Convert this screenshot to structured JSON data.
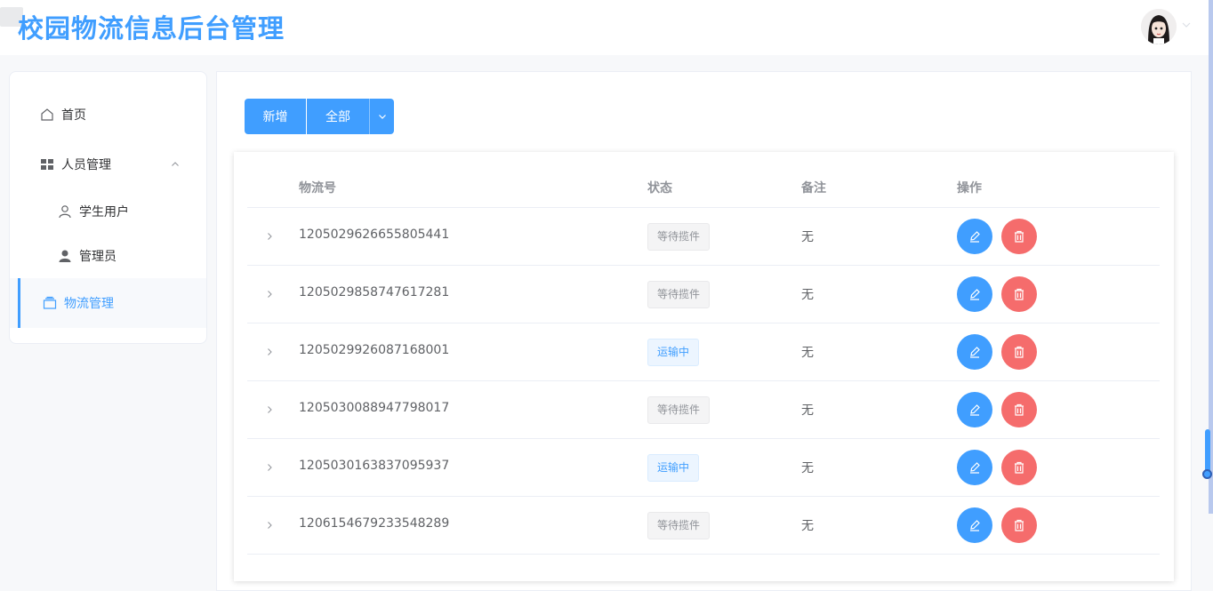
{
  "header": {
    "title": "校园物流信息后台管理"
  },
  "sidebar": {
    "items": [
      {
        "label": "首页",
        "icon": "home-icon"
      },
      {
        "label": "人员管理",
        "icon": "grid-icon"
      },
      {
        "label": "学生用户",
        "icon": "user-outline-icon"
      },
      {
        "label": "管理员",
        "icon": "user-filled-icon"
      },
      {
        "label": "物流管理",
        "icon": "box-icon"
      }
    ]
  },
  "toolbar": {
    "add_label": "新增",
    "filter_label": "全部"
  },
  "table": {
    "columns": [
      "物流号",
      "状态",
      "备注",
      "操作"
    ],
    "rows": [
      {
        "id": "1205029626655805441",
        "status": "等待揽件",
        "note": "无"
      },
      {
        "id": "1205029858747617281",
        "status": "等待揽件",
        "note": "无"
      },
      {
        "id": "1205029926087168001",
        "status": "运输中",
        "note": "无"
      },
      {
        "id": "1205030088947798017",
        "status": "等待揽件",
        "note": "无"
      },
      {
        "id": "1205030163837095937",
        "status": "运输中",
        "note": "无"
      },
      {
        "id": "1206154679233548289",
        "status": "等待揽件",
        "note": "无"
      }
    ]
  },
  "colors": {
    "primary": "#409eff",
    "danger": "#f56c6c",
    "tag_info": "#909399"
  }
}
